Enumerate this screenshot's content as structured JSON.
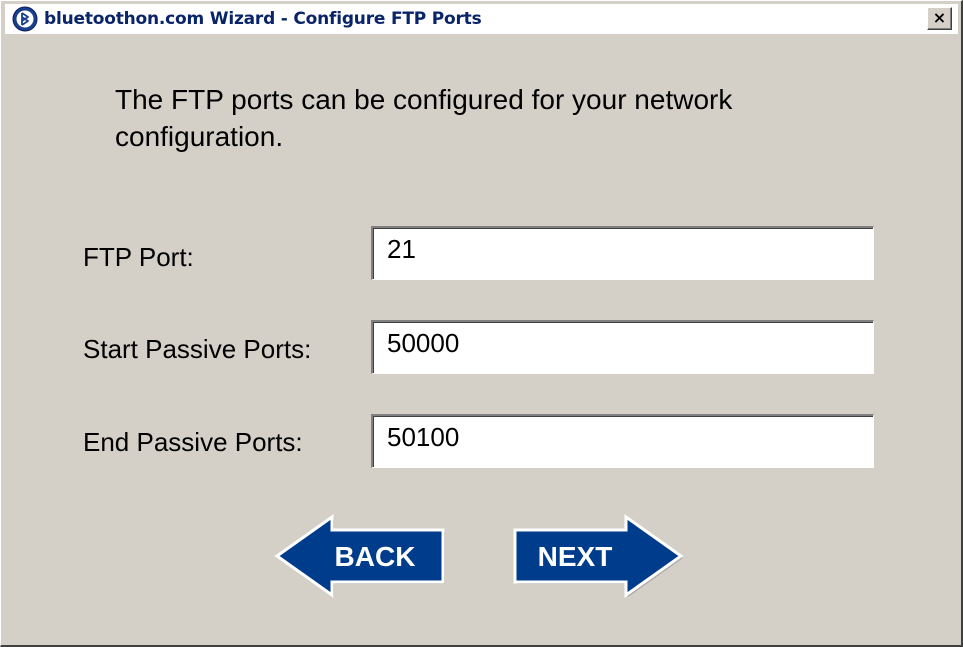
{
  "window": {
    "title": "bluetoothon.com Wizard - Configure FTP Ports",
    "close_glyph": "×",
    "app_icon": "bluetooth-logo-icon"
  },
  "intro_text": "The FTP ports can be configured for your network configuration.",
  "fields": {
    "ftp_port": {
      "label": "FTP Port:",
      "value": "21"
    },
    "start_passive": {
      "label": "Start Passive Ports:",
      "value": "50000"
    },
    "end_passive": {
      "label": "End Passive Ports:",
      "value": "50100"
    }
  },
  "buttons": {
    "back": {
      "label": "BACK",
      "icon": "left-arrow"
    },
    "next": {
      "label": "NEXT",
      "icon": "right-arrow"
    }
  },
  "colors": {
    "window_bg": "#d4d0c8",
    "title_text": "#0a246a",
    "button_fill": "#003c8c"
  }
}
